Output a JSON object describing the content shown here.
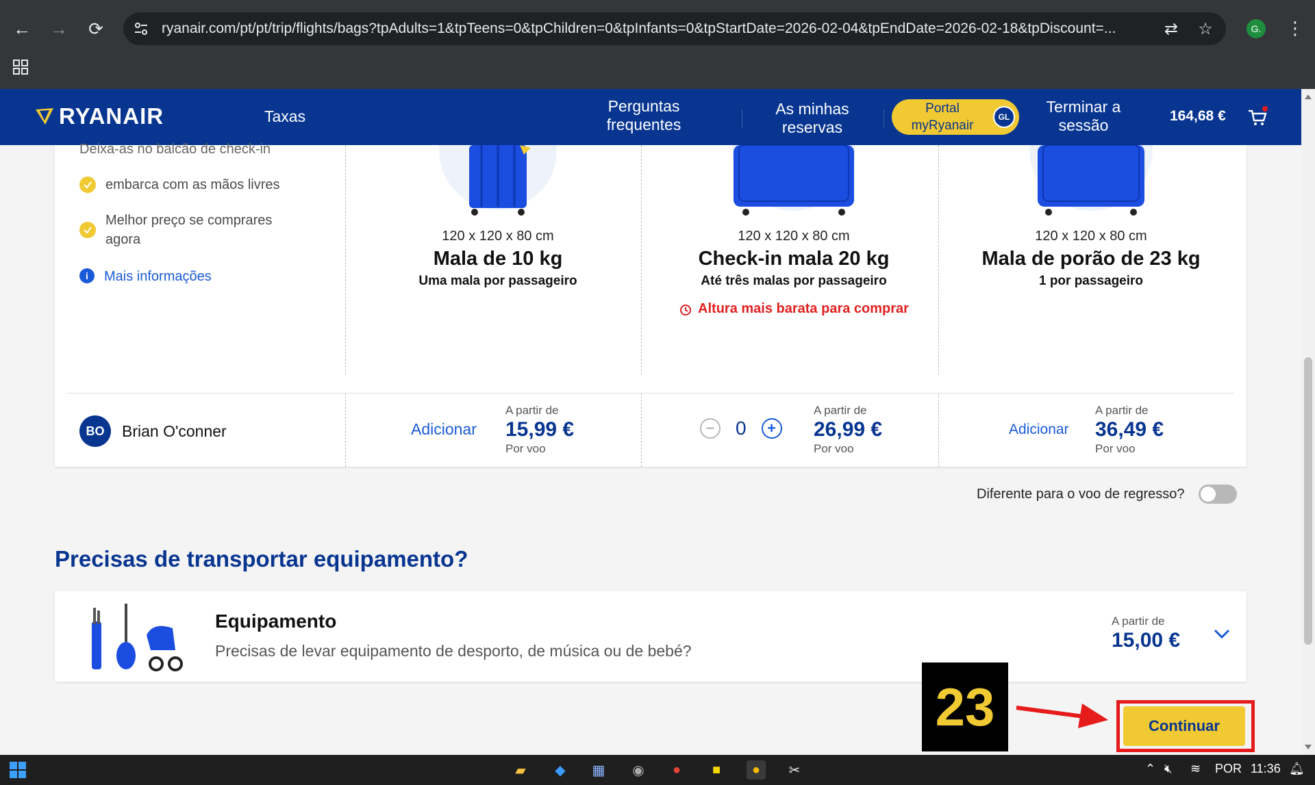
{
  "browser": {
    "url": "ryanair.com/pt/pt/trip/flights/bags?tpAdults=1&tpTeens=0&tpChildren=0&tpInfants=0&tpStartDate=2026-02-04&tpEndDate=2026-02-18&tpDiscount=...",
    "profile_initial": "G."
  },
  "header": {
    "logo": "RYANAIR",
    "nav": {
      "taxas": "Taxas",
      "faq_line1": "Perguntas",
      "faq_line2": "frequentes",
      "reservas_line1": "As minhas",
      "reservas_line2": "reservas",
      "portal_line1": "Portal",
      "portal_line2": "myRyanair",
      "portal_badge": "GL",
      "logout_line1": "Terminar a",
      "logout_line2": "sessão"
    },
    "total_price": "164,68 €"
  },
  "info": {
    "partial_top": "Deixa-as no balcão de check-in",
    "items": [
      "embarca com as mãos livres",
      "Melhor preço se comprares agora"
    ],
    "more_link": "Mais informações"
  },
  "bags": [
    {
      "dims": "120 x 120 x 80 cm",
      "name": "Mala de 10 kg",
      "sub": "Uma mala por passageiro",
      "price_from": "A partir de",
      "price": "15,99 €",
      "per": "Por voo",
      "action": "Adicionar"
    },
    {
      "dims": "120 x 120 x 80 cm",
      "name": "Check-in mala 20 kg",
      "sub": "Até três malas por passageiro",
      "promo": "Altura mais barata para comprar",
      "price_from": "A partir de",
      "price": "26,99 €",
      "per": "Por voo",
      "count": "0"
    },
    {
      "dims": "120 x 120 x 80 cm",
      "name": "Mala de porão de 23 kg",
      "sub": "1 por passageiro",
      "price_from": "A partir de",
      "price": "36,49 €",
      "per": "Por voo",
      "action": "Adicionar"
    }
  ],
  "passenger": {
    "initials": "BO",
    "name": "Brian O'conner"
  },
  "return_toggle": {
    "label": "Diferente para o voo de regresso?",
    "on": false
  },
  "equipment": {
    "section_title": "Precisas de transportar equipamento?",
    "title": "Equipamento",
    "desc": "Precisas de levar equipamento de desporto, de música ou de bebé?",
    "price_from": "A partir de",
    "price": "15,00 €"
  },
  "continue_label": "Continuar",
  "annotation": {
    "step": "23"
  },
  "taskbar": {
    "lang": "POR",
    "time": "11:36"
  },
  "colors": {
    "ryanair_blue": "#073590",
    "ryanair_yellow": "#f1c933",
    "link_blue": "#1a5ad8",
    "alert_red": "#e02020"
  }
}
